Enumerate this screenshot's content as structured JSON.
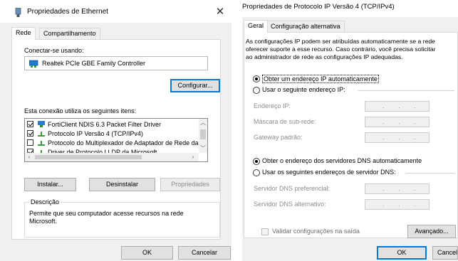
{
  "left": {
    "title": "Propriedades de Ethernet",
    "close_glyph": "✕",
    "tabs": [
      "Rede",
      "Compartilhamento"
    ],
    "connect_using_label": "Conectar-se usando:",
    "adapter_name": "Realtek PCIe GBE Family Controller",
    "configure_button": "Configurar...",
    "items_label": "Esta conexão utiliza os seguintes itens:",
    "items": [
      {
        "text": "FortiClient NDIS 6.3 Packet Filter Driver",
        "checked": true,
        "icon": "network-client-icon"
      },
      {
        "text": "Protocolo IP Versão 4 (TCP/IPv4)",
        "checked": true,
        "icon": "protocol-icon"
      },
      {
        "text": "Protocolo do Multiplexador de Adaptador de Rede da M",
        "checked": false,
        "icon": "protocol-icon"
      },
      {
        "text": "Driver de Protocolo LLDP da Microsoft",
        "checked": true,
        "icon": "protocol-icon"
      }
    ],
    "install_button": "Instalar...",
    "uninstall_button": "Desinstalar",
    "properties_button": "Propriedades",
    "description_legend": "Descrição",
    "description_text_line1": "Permite que seu computador acesse recursos na rede",
    "description_text_line2": "Microsoft.",
    "ok_button": "OK",
    "cancel_button": "Cancelar"
  },
  "right": {
    "title": "Propriedades de Protocolo IP Versão 4 (TCP/IPv4)",
    "tabs": [
      "Geral",
      "Configuração alternativa"
    ],
    "info_line1": "As configurações IP podem ser atribuídas automaticamente se a rede",
    "info_line2": "oferecer suporte a esse recurso. Caso contrário, você precisa solicitar",
    "info_line3": "ao administrador de rede as configurações IP adequadas.",
    "radio_auto_ip": "Obter um endereço IP automaticamente",
    "radio_manual_ip": "Usar o seguinte endereço IP:",
    "ip_address_label": "Endereço IP:",
    "subnet_label": "Máscara de sub-rede:",
    "gateway_label": "Gateway padrão:",
    "radio_auto_dns": "Obter o endereço dos servidores DNS automaticamente",
    "radio_manual_dns": "Usar os seguintes endereços de servidor DNS:",
    "preferred_dns_label": "Servidor DNS preferencial:",
    "alternate_dns_label": "Servidor DNS alternativo:",
    "ip_dot": ".",
    "validate_label": "Validar configurações na saída",
    "advanced_button": "Avançado...",
    "ok_button": "OK",
    "cancel_button": "Cancela"
  },
  "colors": {
    "dialog_bg": "#f0f0f0",
    "panel_bg": "#ffffff",
    "focus_blue": "#0078d7",
    "disabled_text": "#8d8d8d"
  }
}
